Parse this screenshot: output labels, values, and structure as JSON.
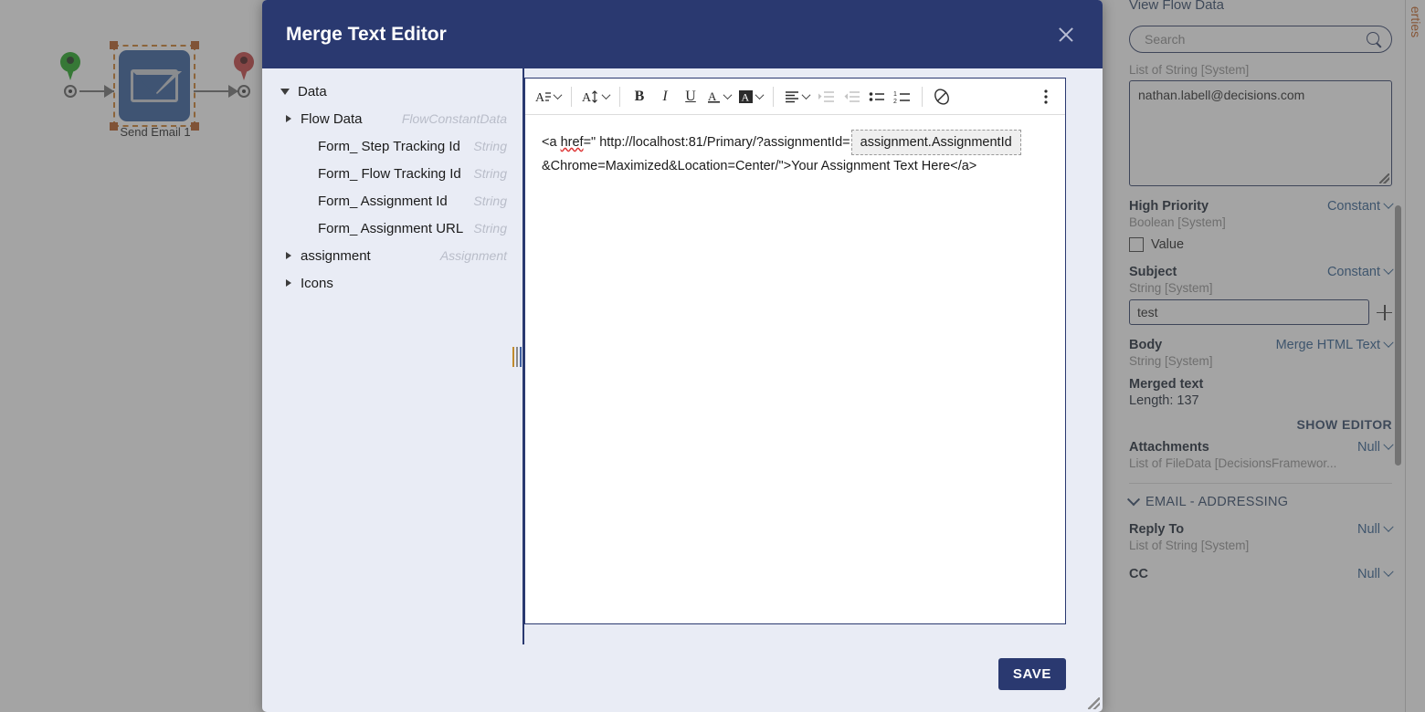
{
  "canvas": {
    "node_label": "Send Email 1",
    "start_pin": "start-pin",
    "end_pin": "end-pin",
    "node_icon": "envelope-icon"
  },
  "right_panel": {
    "title": "View Flow Data",
    "search_placeholder": "Search",
    "search_value": "",
    "to_type": "List of String [System]",
    "to_value": "nathan.labell@decisions.com",
    "rows": [
      {
        "name": "High Priority",
        "mapping": "Constant",
        "type": "Boolean [System]",
        "checkbox_label": "Value"
      },
      {
        "name": "Subject",
        "mapping": "Constant",
        "type": "String [System]",
        "input_value": "test"
      },
      {
        "name": "Body",
        "mapping": "Merge HTML Text",
        "type": "String [System]",
        "merged_label": "Merged text",
        "length_label": "Length: 137",
        "show_editor": "SHOW EDITOR"
      },
      {
        "name": "Attachments",
        "mapping": "Null",
        "type": "List of FileData [DecisionsFramewor..."
      }
    ],
    "section": {
      "title": "EMAIL - ADDRESSING",
      "rows": [
        {
          "name": "Reply To",
          "mapping": "Null",
          "type": "List of String [System]"
        },
        {
          "name": "CC",
          "mapping": "Null",
          "type": ""
        }
      ]
    },
    "vertical_tab": "erties"
  },
  "modal": {
    "title": "Merge Text Editor",
    "close_icon": "close-icon",
    "save_label": "SAVE",
    "tree": [
      {
        "label": "Data",
        "type": "",
        "state": "open",
        "level": 1
      },
      {
        "label": "Flow Data",
        "type": "FlowConstantData",
        "state": "closed",
        "level": 2
      },
      {
        "label": "Form_ Step Tracking Id",
        "type": "String",
        "state": "leaf",
        "level": 3
      },
      {
        "label": "Form_ Flow Tracking Id",
        "type": "String",
        "state": "leaf",
        "level": 3
      },
      {
        "label": "Form_ Assignment Id",
        "type": "String",
        "state": "leaf",
        "level": 3
      },
      {
        "label": "Form_ Assignment URL",
        "type": "String",
        "state": "leaf",
        "level": 3
      },
      {
        "label": "assignment",
        "type": "Assignment",
        "state": "closed",
        "level": 2
      },
      {
        "label": "Icons",
        "type": "",
        "state": "closed",
        "level": 2
      }
    ],
    "toolbar": [
      {
        "name": "paragraph-format-button",
        "glyph": "A",
        "caret": true
      },
      {
        "name": "font-size-button",
        "glyph": "A",
        "caret": true
      },
      {
        "name": "bold-button",
        "glyph": "B",
        "caret": false
      },
      {
        "name": "italic-button",
        "glyph": "I",
        "caret": false
      },
      {
        "name": "underline-button",
        "glyph": "U",
        "caret": false
      },
      {
        "name": "text-color-button",
        "glyph": "A",
        "caret": true
      },
      {
        "name": "highlight-color-button",
        "glyph": "A",
        "caret": true
      },
      {
        "name": "align-button",
        "glyph": "align",
        "caret": true
      },
      {
        "name": "indent-button",
        "glyph": "indent",
        "caret": false
      },
      {
        "name": "outdent-button",
        "glyph": "outdent",
        "caret": false
      },
      {
        "name": "bullet-list-button",
        "glyph": "bullets",
        "caret": false
      },
      {
        "name": "numbered-list-button",
        "glyph": "numbers",
        "caret": false
      },
      {
        "name": "insert-link-button",
        "glyph": "link",
        "caret": false
      },
      {
        "name": "more-options-button",
        "glyph": "kebab",
        "caret": false
      }
    ],
    "content": {
      "part1_pre": "<a ",
      "part1_spell": "href",
      "part1_post": "=\" http://localhost:81/Primary/?assignmentId=",
      "token": "assignment.AssignmentId",
      "part2": "&Chrome=Maximized&Location=Center/\">Your Assignment Text Here</a>"
    }
  }
}
